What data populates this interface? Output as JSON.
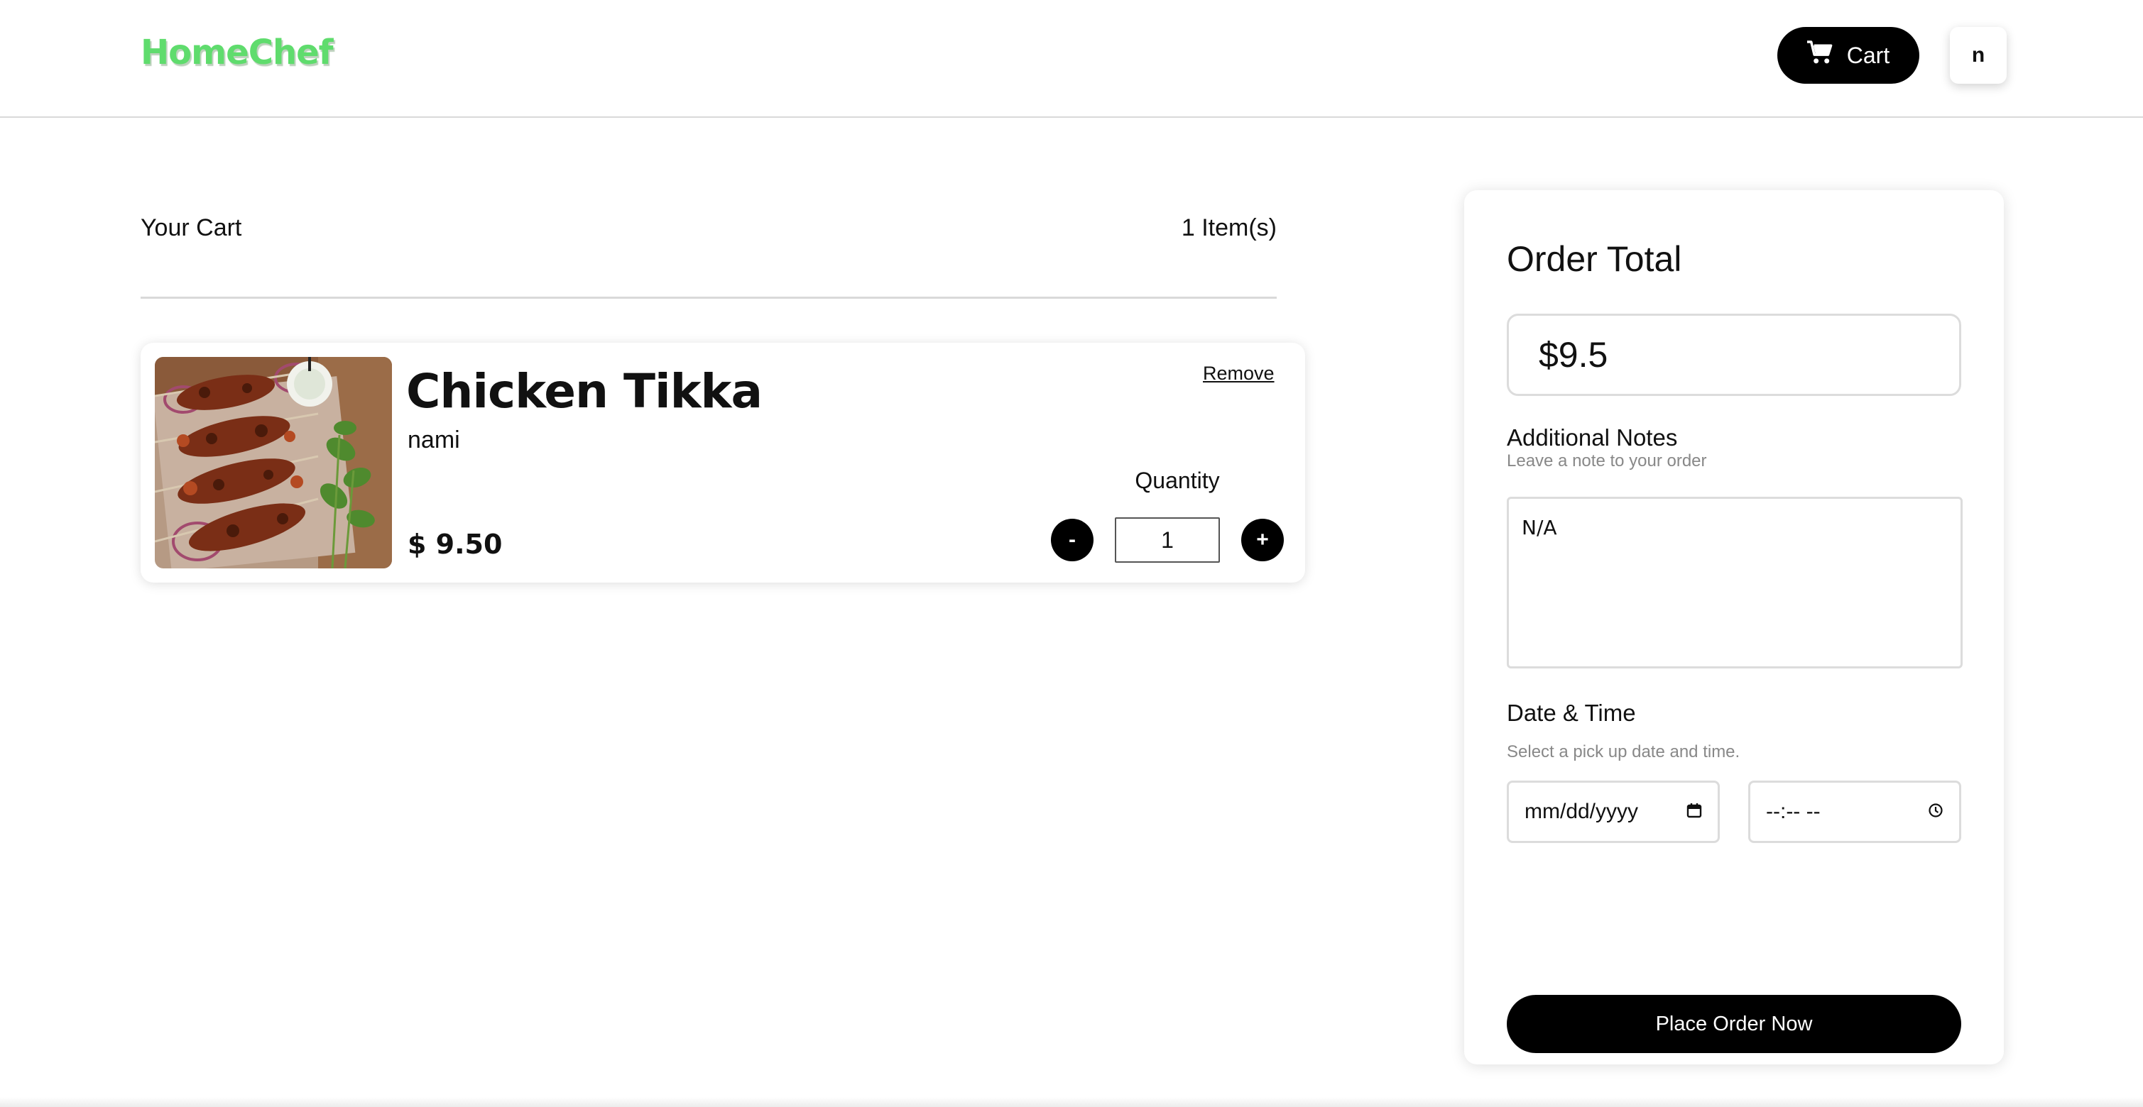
{
  "brand": {
    "logo_text": "HomeChef",
    "logo_color": "#5fdc6d"
  },
  "header": {
    "cart_label": "Cart",
    "cart_icon": "shopping-cart-icon",
    "user_initial": "n"
  },
  "cart": {
    "title": "Your Cart",
    "count_label": "1 Item(s)",
    "items": [
      {
        "name": "Chicken Tikka",
        "chef": "nami",
        "price": "$ 9.50",
        "remove_label": "Remove",
        "quantity_label": "Quantity",
        "quantity": "1",
        "decrement_label": "-",
        "increment_label": "+",
        "image": "chicken-tikka-skewers-image"
      }
    ]
  },
  "order": {
    "title": "Order Total",
    "total": "$9.5",
    "notes_label": "Additional Notes",
    "notes_hint": "Leave a note to your order",
    "notes_value": "N/A",
    "datetime_label": "Date & Time",
    "datetime_hint": "Select a pick up date and time.",
    "date_placeholder": "mm/dd/yyyy",
    "date_icon": "calendar-icon",
    "time_placeholder": "--:-- --",
    "time_icon": "clock-icon",
    "place_order_label": "Place Order Now"
  }
}
